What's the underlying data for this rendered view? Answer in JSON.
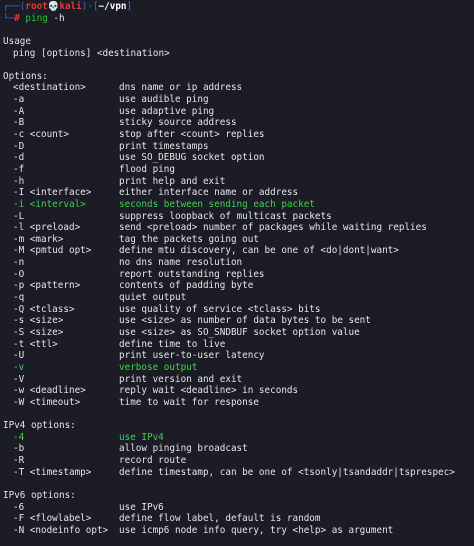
{
  "prompt": {
    "corner_top": "┌──(",
    "user": "root",
    "skull": "💀",
    "host": "kali",
    "mid": ")-[",
    "cwd": "~/vpn",
    "end": "]",
    "corner_bottom": "└─",
    "hash": "#",
    "command": "ping",
    "arg": "-h"
  },
  "usage": {
    "heading": "Usage",
    "line": "ping [options] <destination>"
  },
  "options": {
    "heading": "Options:",
    "items": [
      {
        "flag": "<destination>",
        "desc": "dns name or ip address",
        "hl": false
      },
      {
        "flag": "-a",
        "desc": "use audible ping",
        "hl": false
      },
      {
        "flag": "-A",
        "desc": "use adaptive ping",
        "hl": false
      },
      {
        "flag": "-B",
        "desc": "sticky source address",
        "hl": false
      },
      {
        "flag": "-c <count>",
        "desc": "stop after <count> replies",
        "hl": false
      },
      {
        "flag": "-D",
        "desc": "print timestamps",
        "hl": false
      },
      {
        "flag": "-d",
        "desc": "use SO_DEBUG socket option",
        "hl": false
      },
      {
        "flag": "-f",
        "desc": "flood ping",
        "hl": false
      },
      {
        "flag": "-h",
        "desc": "print help and exit",
        "hl": false
      },
      {
        "flag": "-I <interface>",
        "desc": "either interface name or address",
        "hl": false
      },
      {
        "flag": "-i <interval>",
        "desc": "seconds between sending each packet",
        "hl": true
      },
      {
        "flag": "-L",
        "desc": "suppress loopback of multicast packets",
        "hl": false
      },
      {
        "flag": "-l <preload>",
        "desc": "send <preload> number of packages while waiting replies",
        "hl": false
      },
      {
        "flag": "-m <mark>",
        "desc": "tag the packets going out",
        "hl": false
      },
      {
        "flag": "-M <pmtud opt>",
        "desc": "define mtu discovery, can be one of <do|dont|want>",
        "hl": false
      },
      {
        "flag": "-n",
        "desc": "no dns name resolution",
        "hl": false
      },
      {
        "flag": "-O",
        "desc": "report outstanding replies",
        "hl": false
      },
      {
        "flag": "-p <pattern>",
        "desc": "contents of padding byte",
        "hl": false
      },
      {
        "flag": "-q",
        "desc": "quiet output",
        "hl": false
      },
      {
        "flag": "-Q <tclass>",
        "desc": "use quality of service <tclass> bits",
        "hl": false
      },
      {
        "flag": "-s <size>",
        "desc": "use <size> as number of data bytes to be sent",
        "hl": false
      },
      {
        "flag": "-S <size>",
        "desc": "use <size> as SO_SNDBUF socket option value",
        "hl": false
      },
      {
        "flag": "-t <ttl>",
        "desc": "define time to live",
        "hl": false
      },
      {
        "flag": "-U",
        "desc": "print user-to-user latency",
        "hl": false
      },
      {
        "flag": "-v",
        "desc": "verbose output",
        "hl": true
      },
      {
        "flag": "-V",
        "desc": "print version and exit",
        "hl": false
      },
      {
        "flag": "-w <deadline>",
        "desc": "reply wait <deadline> in seconds",
        "hl": false
      },
      {
        "flag": "-W <timeout>",
        "desc": "time to wait for response",
        "hl": false
      }
    ]
  },
  "ipv4": {
    "heading": "IPv4 options:",
    "items": [
      {
        "flag": "-4",
        "desc": "use IPv4",
        "hl": true
      },
      {
        "flag": "-b",
        "desc": "allow pinging broadcast",
        "hl": false
      },
      {
        "flag": "-R",
        "desc": "record route",
        "hl": false
      },
      {
        "flag": "-T <timestamp>",
        "desc": "define timestamp, can be one of <tsonly|tsandaddr|tsprespec>",
        "hl": false
      }
    ]
  },
  "ipv6": {
    "heading": "IPv6 options:",
    "items": [
      {
        "flag": "-6",
        "desc": "use IPv6",
        "hl": false
      },
      {
        "flag": "-F <flowlabel>",
        "desc": "define flow label, default is random",
        "hl": false
      },
      {
        "flag": "-N <nodeinfo opt>",
        "desc": "use icmp6 node info query, try <help> as argument",
        "hl": false
      }
    ]
  },
  "colors": {
    "background": "#1b1c26",
    "text": "#e6e6e6",
    "highlight": "#3fd24a",
    "prompt_red": "#e33b3b",
    "prompt_blue": "#2f6fe0"
  }
}
